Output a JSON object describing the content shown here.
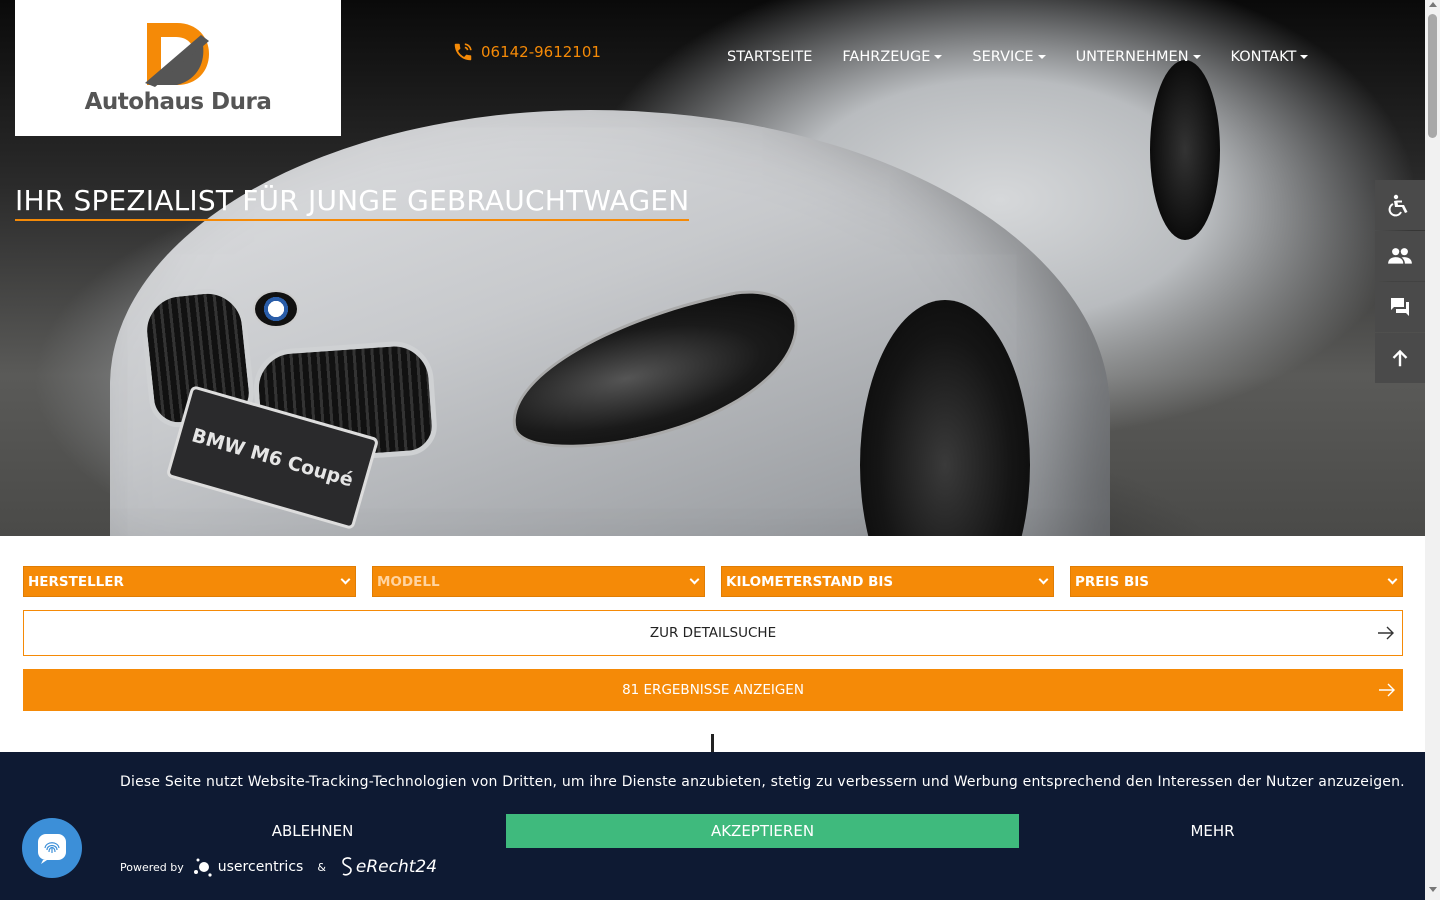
{
  "logo": {
    "text": "Autohaus Dura"
  },
  "header": {
    "phone": "06142-9612101",
    "nav": [
      {
        "label": "STARTSEITE",
        "dropdown": false
      },
      {
        "label": "FAHRZEUGE",
        "dropdown": true
      },
      {
        "label": "SERVICE",
        "dropdown": true
      },
      {
        "label": "UNTERNEHMEN",
        "dropdown": true
      },
      {
        "label": "KONTAKT",
        "dropdown": true
      }
    ]
  },
  "hero": {
    "title": "IHR SPEZIALIST FÜR JUNGE GEBRAUCHTWAGEN",
    "plate_text": "BMW M6 Coupé"
  },
  "side_tools": [
    "accessibility-icon",
    "people-icon",
    "chat-icon",
    "arrow-up-icon"
  ],
  "search": {
    "selects": [
      {
        "label": "HERSTELLER",
        "disabled": false
      },
      {
        "label": "MODELL",
        "disabled": true
      },
      {
        "label": "KILOMETERSTAND BIS",
        "disabled": false
      },
      {
        "label": "PREIS BIS",
        "disabled": false
      }
    ],
    "detail_label": "ZUR DETAILSUCHE",
    "results_label": "81 ERGEBNISSE ANZEIGEN"
  },
  "cookie": {
    "text": "Diese Seite nutzt Website-Tracking-Technologien von Dritten, um ihre Dienste anzubieten, stetig zu verbessern und Werbung entsprechend den Interessen der Nutzer anzuzeigen.",
    "decline_label": "ABLEHNEN",
    "accept_label": "AKZEPTIEREN",
    "more_label": "MEHR",
    "powered_by": "Powered by",
    "usercentrics": "usercentrics",
    "amp": "&",
    "erecht": "eRecht24"
  },
  "colors": {
    "accent": "#f58a07",
    "banner": "#0e1a33",
    "accept": "#3fba7d",
    "tool_bg": "#4a4a4a"
  }
}
